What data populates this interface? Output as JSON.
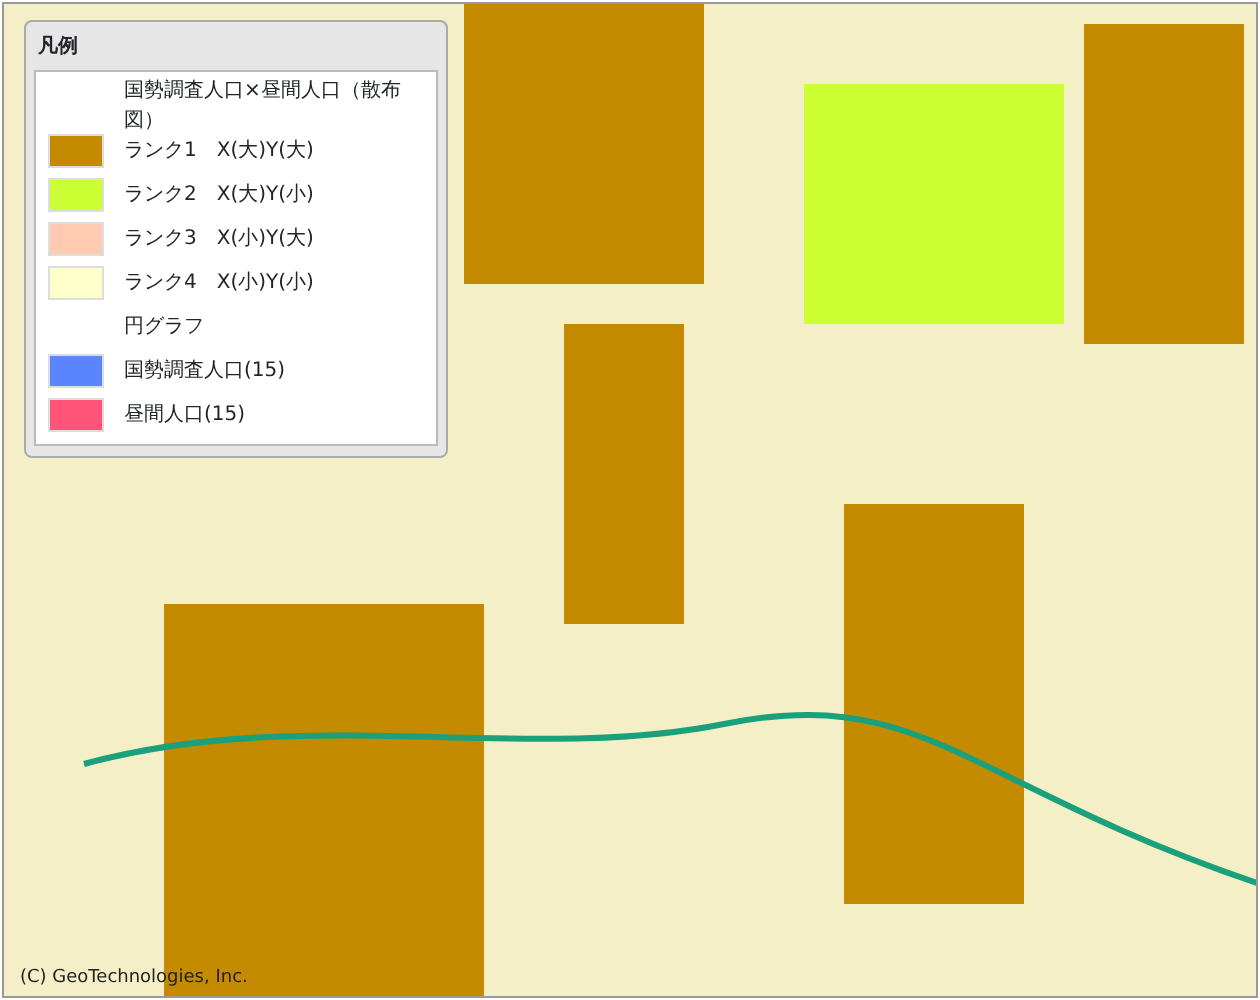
{
  "legend": {
    "title": "凡例",
    "items": [
      {
        "kind": "heading",
        "label": "国勢調査人口×昼間人口（散布図）"
      },
      {
        "kind": "swatch",
        "label": "ランク1　X(大)Y(大)",
        "color": "#c48a00"
      },
      {
        "kind": "swatch",
        "label": "ランク2　X(大)Y(小)",
        "color": "#ccff33"
      },
      {
        "kind": "swatch",
        "label": "ランク3　X(小)Y(大)",
        "color": "#ffcbb0"
      },
      {
        "kind": "swatch",
        "label": "ランク4　X(小)Y(小)",
        "color": "#ffffcc"
      },
      {
        "kind": "heading",
        "label": "円グラフ"
      },
      {
        "kind": "swatch",
        "label": "国勢調査人口(15)",
        "color": "#5b84ff"
      },
      {
        "kind": "swatch",
        "label": "昼間人口(15)",
        "color": "#ff5377"
      }
    ]
  },
  "map": {
    "copyright": "(C) GeoTechnologies, Inc."
  }
}
